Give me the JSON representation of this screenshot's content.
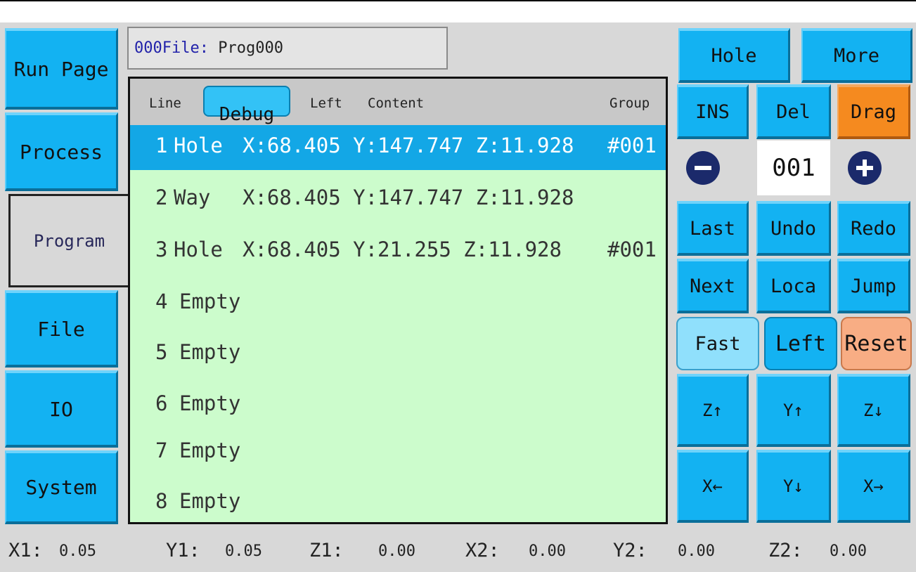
{
  "nav": {
    "run_page": "Run Page",
    "process": "Process",
    "program": "Program",
    "file": "File",
    "io": "IO",
    "system": "System"
  },
  "file_info": {
    "label": "000File:",
    "name": "Prog000"
  },
  "program": {
    "headers": {
      "line": "Line",
      "debug": "Debug",
      "left": "Left",
      "content": "Content",
      "group": "Group"
    },
    "rows": [
      {
        "num": "1",
        "type": "Hole",
        "coords": "X:68.405 Y:147.747 Z:11.928",
        "group": "#001"
      },
      {
        "num": "2",
        "type": "Way ",
        "coords": "X:68.405 Y:147.747 Z:11.928",
        "group": ""
      },
      {
        "num": "3",
        "type": "Hole",
        "coords": "X:68.405 Y:21.255 Z:11.928",
        "group": "#001"
      },
      {
        "num": "4",
        "type": "Empty",
        "coords": "",
        "group": ""
      },
      {
        "num": "5",
        "type": "Empty",
        "coords": "",
        "group": ""
      },
      {
        "num": "6",
        "type": "Empty",
        "coords": "",
        "group": ""
      },
      {
        "num": "7",
        "type": "Empty",
        "coords": "",
        "group": ""
      },
      {
        "num": "8",
        "type": "Empty",
        "coords": "",
        "group": ""
      }
    ],
    "selected_row": 1
  },
  "controls": {
    "hole": "Hole",
    "more": "More",
    "ins": "INS",
    "del": "Del",
    "drag": "Drag",
    "counter": "001",
    "last": "Last",
    "undo": "Undo",
    "redo": "Redo",
    "next": "Next",
    "loca": "Loca",
    "jump": "Jump",
    "fast": "Fast",
    "left": "Left",
    "reset": "Reset",
    "z_up": "Z↑",
    "y_up": "Y↑",
    "z_down": "Z↓",
    "x_left": "X←",
    "y_down": "Y↓",
    "x_right": "X→"
  },
  "status": {
    "x1_label": "X1:",
    "x1": "0.05",
    "y1_label": "Y1:",
    "y1": "0.05",
    "z1_label": "Z1:",
    "z1": "0.00",
    "x2_label": "X2:",
    "x2": "0.00",
    "y2_label": "Y2:",
    "y2": "0.00",
    "z2_label": "Z2:",
    "z2": "0.00"
  },
  "colors": {
    "button": "#13b2f2",
    "drag": "#f58a1f",
    "fast": "#90e0fc",
    "reset": "#f8ad84",
    "program_bg": "#ccfccc",
    "selected_row": "#13a7e6",
    "circle": "#1b2a6b"
  }
}
